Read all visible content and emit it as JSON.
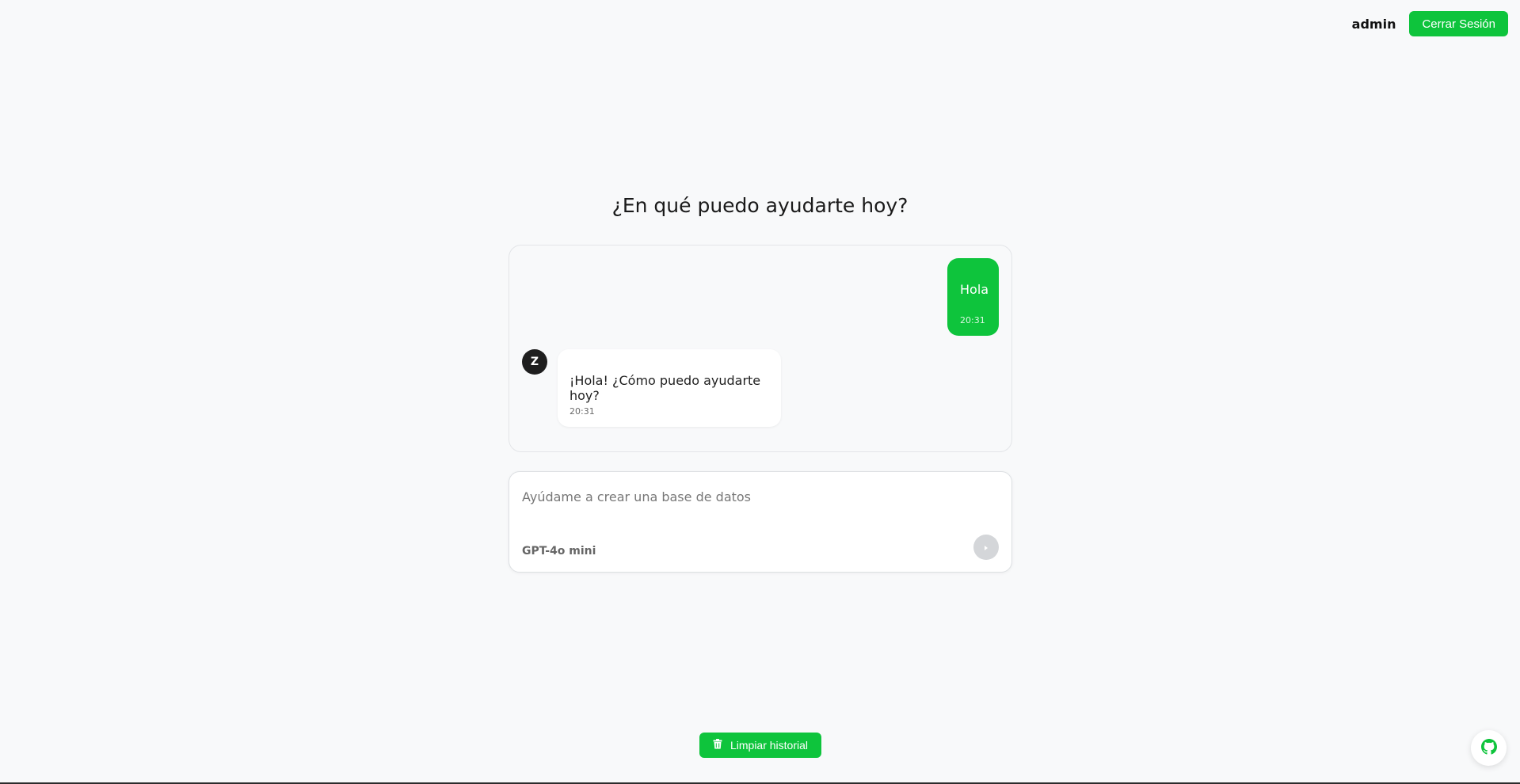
{
  "header": {
    "username": "admin",
    "logout_label": "Cerrar Sesión"
  },
  "main": {
    "heading": "¿En qué puedo ayudarte hoy?"
  },
  "chat": {
    "messages": [
      {
        "role": "user",
        "text": "Hola",
        "time": "20:31"
      },
      {
        "role": "assistant",
        "avatar": "Z",
        "text": "¡Hola! ¿Cómo puedo ayudarte hoy?",
        "time": "20:31"
      }
    ]
  },
  "composer": {
    "placeholder": "Ayúdame a crear una base de datos",
    "value": "",
    "model": "GPT-4o mini",
    "send_icon": "send-arrow-icon"
  },
  "footer": {
    "clear_label": "Limpiar historial",
    "clear_icon": "trash-icon",
    "github_icon": "github-icon"
  },
  "colors": {
    "accent": "#0ec43c",
    "background": "#f8f9fa",
    "avatar": "#1e1e1e"
  }
}
